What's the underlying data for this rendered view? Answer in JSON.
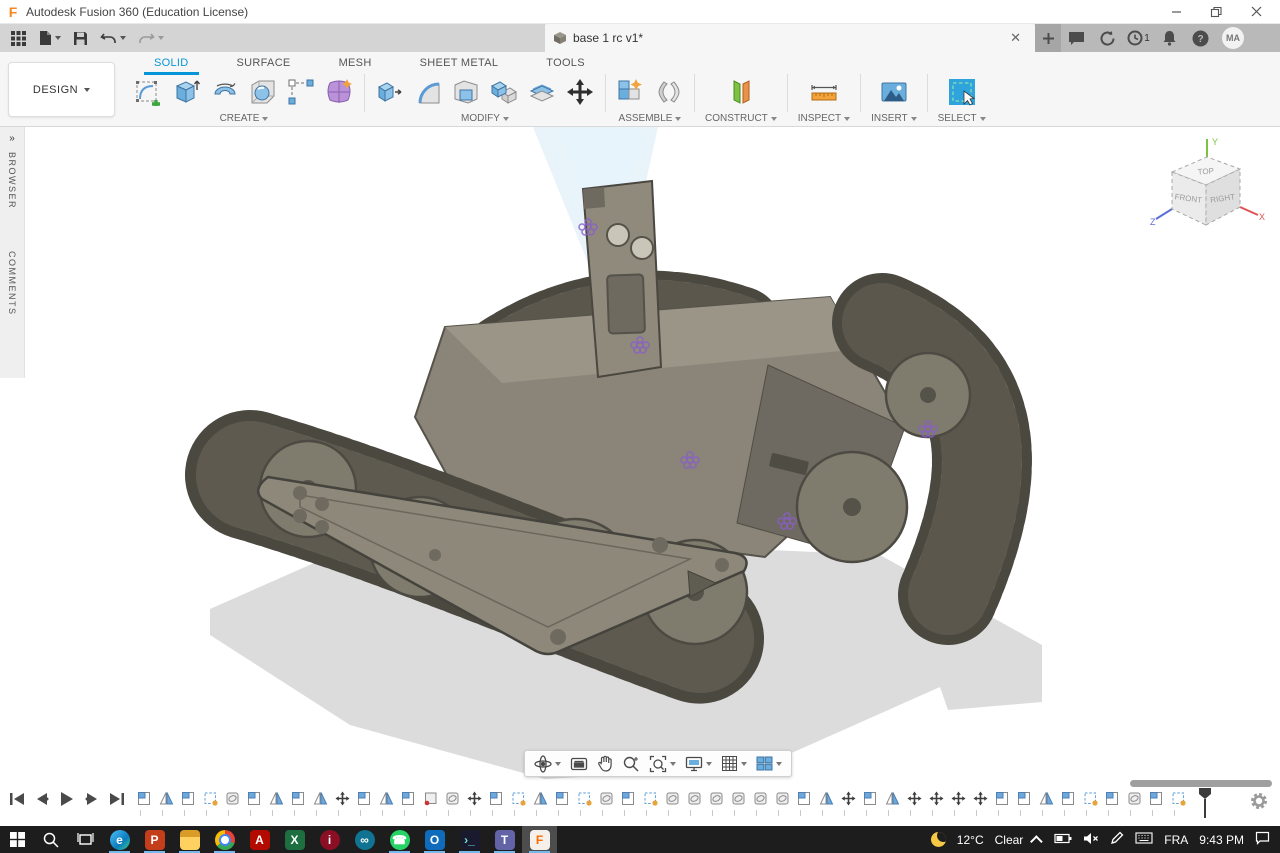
{
  "window": {
    "title": "Autodesk Fusion 360 (Education License)",
    "logo_glyph": "F"
  },
  "doc_tab": {
    "title": "base 1 rc v1*"
  },
  "header": {
    "clock_badge": "1",
    "avatar_initials": "MA"
  },
  "ribbon": {
    "mode_button": "DESIGN",
    "tabs": [
      {
        "label": "SOLID",
        "active": true
      },
      {
        "label": "SURFACE",
        "active": false
      },
      {
        "label": "MESH",
        "active": false
      },
      {
        "label": "SHEET METAL",
        "active": false
      },
      {
        "label": "TOOLS",
        "active": false
      }
    ],
    "groups": [
      {
        "label": "CREATE"
      },
      {
        "label": "MODIFY"
      },
      {
        "label": "ASSEMBLE"
      },
      {
        "label": "CONSTRUCT"
      },
      {
        "label": "INSPECT"
      },
      {
        "label": "INSERT"
      },
      {
        "label": "SELECT"
      }
    ]
  },
  "side_panel": {
    "browser_label": "BROWSER",
    "comments_label": "COMMENTS",
    "expand_glyph": "»"
  },
  "viewcube": {
    "top": "TOP",
    "front": "FRONT",
    "right": "RIGHT",
    "axis_x": "X",
    "axis_y": "Y",
    "axis_z": "Z"
  },
  "nav_bar": {
    "items": [
      "orbit",
      "look-at",
      "pan",
      "zoom",
      "fit",
      "display-settings",
      "grid-settings",
      "viewports"
    ]
  },
  "timeline": {
    "features": [
      "flag",
      "triangle",
      "flag",
      "sketch",
      "form",
      "flag",
      "triangle",
      "flag",
      "triangle",
      "move",
      "flag",
      "triangle",
      "flag",
      "hole",
      "form",
      "move",
      "flag",
      "sketch",
      "triangle",
      "flag",
      "sketch",
      "form",
      "flag",
      "sketch",
      "form",
      "form",
      "form",
      "form",
      "form",
      "form",
      "flag",
      "triangle",
      "move",
      "flag",
      "triangle",
      "move",
      "move",
      "move",
      "move",
      "flag",
      "flag",
      "triangle",
      "flag",
      "sketch",
      "flag",
      "form",
      "flag",
      "sketch"
    ]
  },
  "taskbar": {
    "apps": [
      {
        "name": "edge",
        "label": "e",
        "fg": "#ffffff",
        "bg": "linear-gradient(135deg,#4bc3fa,#0c7bbd 60%,#35d08c)",
        "shape": "circle",
        "running": true
      },
      {
        "name": "powerpoint",
        "label": "P",
        "fg": "#ffffff",
        "bg": "#c43e1c",
        "shape": "rounded",
        "running": true
      },
      {
        "name": "file-explorer",
        "label": "",
        "fg": "#ffffff",
        "bg": "linear-gradient(180deg,#d99c27 35%,#ffd160 35%)",
        "shape": "rounded",
        "running": true
      },
      {
        "name": "chrome",
        "label": "",
        "fg": "#ffffff",
        "bg": "conic-gradient(#ea4335 0 30%,#34a853 30% 65%,#fbbc05 65% 100%)",
        "shape": "circle",
        "running": true,
        "dot": true
      },
      {
        "name": "acrobat",
        "label": "A",
        "fg": "#ffffff",
        "bg": "#b30b00",
        "shape": "rounded",
        "running": false
      },
      {
        "name": "excel",
        "label": "X",
        "fg": "#ffffff",
        "bg": "#1d6f42",
        "shape": "rounded",
        "running": false
      },
      {
        "name": "info-app",
        "label": "i",
        "fg": "#ffffff",
        "bg": "#8b0f24",
        "shape": "circle",
        "running": false
      },
      {
        "name": "arduino",
        "label": "∞",
        "fg": "#ffffff",
        "bg": "#0f7391",
        "shape": "circle",
        "running": false
      },
      {
        "name": "whatsapp",
        "label": "☎",
        "fg": "#ffffff",
        "bg": "#25d366",
        "shape": "circle",
        "running": true
      },
      {
        "name": "outlook",
        "label": "O",
        "fg": "#ffffff",
        "bg": "#0f6cbd",
        "shape": "rounded",
        "running": true
      },
      {
        "name": "pycharm",
        "label": "›_",
        "fg": "#6ee7d8",
        "bg": "#1a1a2e",
        "shape": "rounded",
        "running": true
      },
      {
        "name": "teams",
        "label": "T",
        "fg": "#ffffff",
        "bg": "#6264a7",
        "shape": "rounded",
        "running": true
      },
      {
        "name": "fusion360",
        "label": "F",
        "fg": "#ff6b00",
        "bg": "#f5f0ea",
        "shape": "rounded",
        "running": true,
        "active": true
      }
    ],
    "tray": {
      "temperature": "12°C",
      "condition": "Clear",
      "language": "FRA",
      "time": "9:43 PM"
    }
  },
  "colors": {
    "accent": "#0696d7",
    "taskbar_bg": "#1d1d1d",
    "shadow": "#dcdcdc"
  }
}
